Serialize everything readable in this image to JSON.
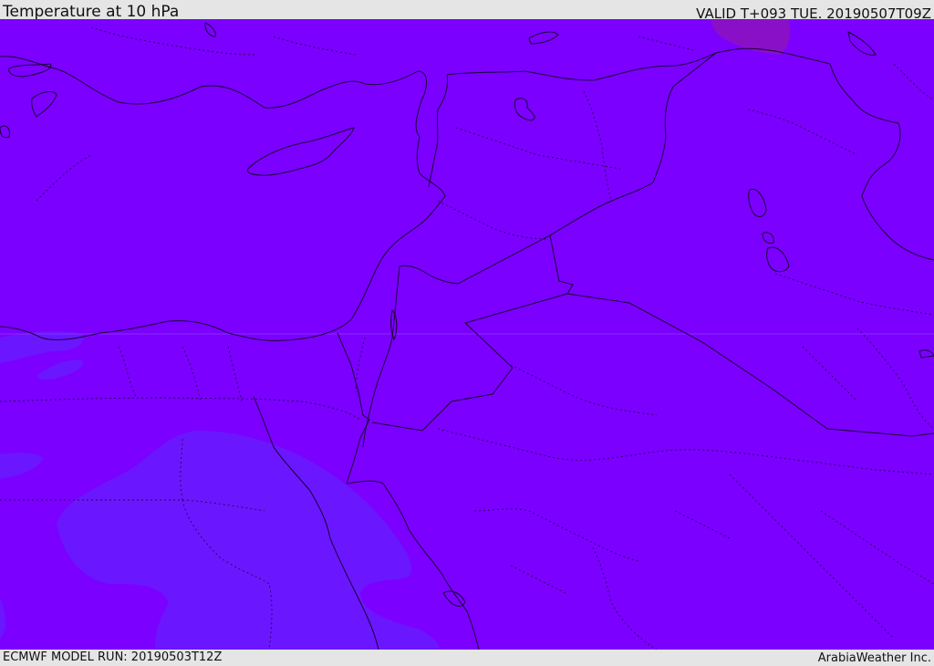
{
  "header": {
    "title": "Temperature at 10 hPa",
    "valid_time": "VALID T+093 TUE. 20190507T09Z"
  },
  "footer": {
    "model_run": "ECMWF MODEL RUN: 20190503T12Z",
    "credit": "ArabiaWeather Inc."
  },
  "map": {
    "fill_colors": {
      "base": "#7b00ff",
      "cooler_band": "#6a17ff",
      "warmer_patch": "#8a10c8"
    }
  }
}
